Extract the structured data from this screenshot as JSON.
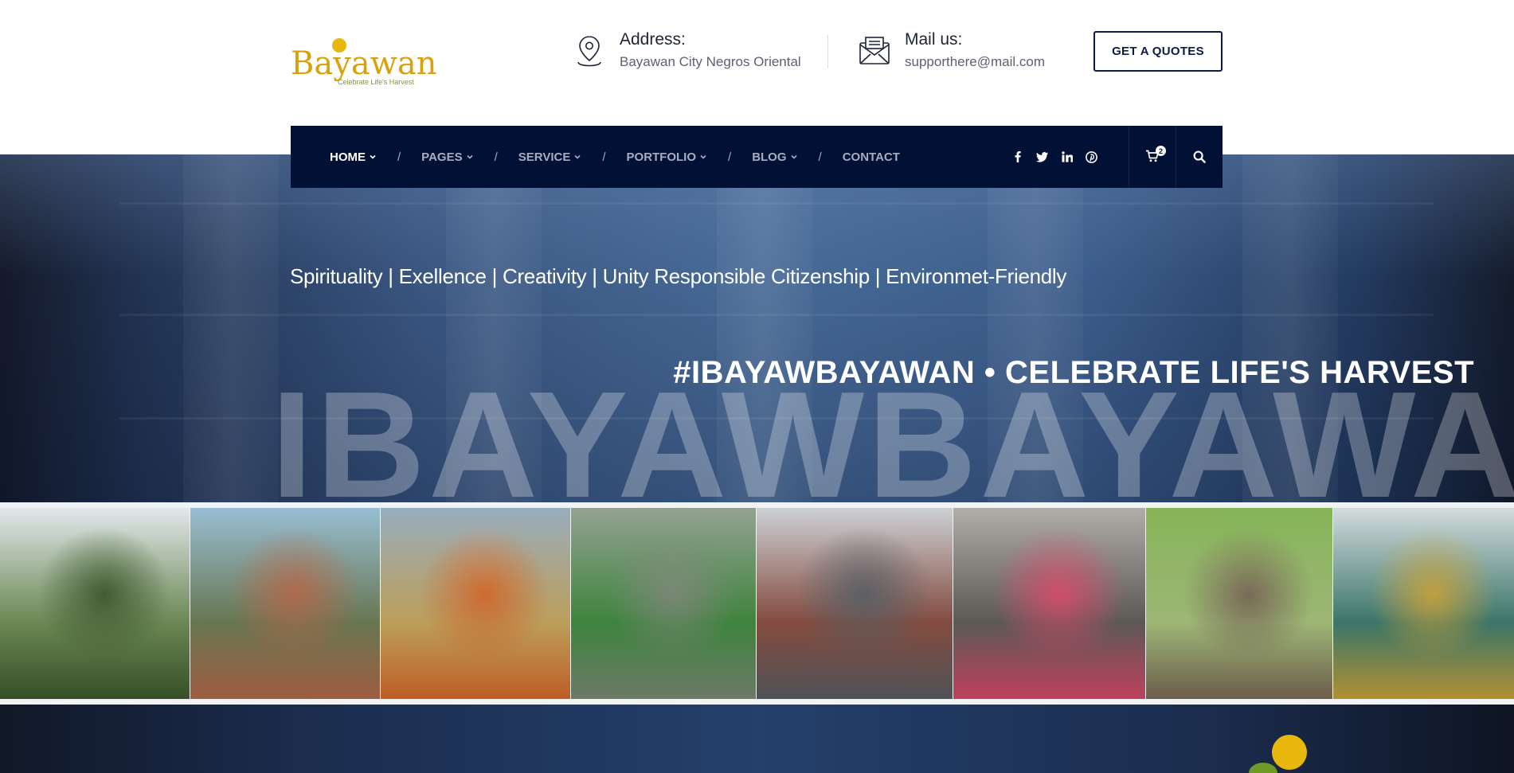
{
  "brand": {
    "logo_text": "Bayawan",
    "logo_tagline": "Celebrate Life's Harvest",
    "colors": {
      "logo_gold": "#d8a20d",
      "logo_green": "#7f9a2e",
      "navy": "#011136"
    }
  },
  "header": {
    "address": {
      "icon": "map-pin-icon",
      "label": "Address:",
      "value": "Bayawan City Negros Oriental"
    },
    "mail": {
      "icon": "envelope-icon",
      "label": "Mail us:",
      "value": "supporthere@mail.com"
    },
    "cta_label": "GET A QUOTES"
  },
  "nav": {
    "items": [
      {
        "label": "HOME",
        "active": true
      },
      {
        "label": "PAGES",
        "active": false
      },
      {
        "label": "SERVICE",
        "active": false
      },
      {
        "label": "PORTFOLIO",
        "active": false
      },
      {
        "label": "BLOG",
        "active": false
      },
      {
        "label": "CONTACT",
        "active": false
      }
    ],
    "separator": "/",
    "socials": [
      "facebook-icon",
      "twitter-icon",
      "linkedin-icon",
      "pinterest-icon"
    ],
    "cart_count": "2"
  },
  "hero": {
    "tagline": "Spirituality | Exellence | Creativity | Unity Responsible Citizenship | Environmet-Friendly",
    "hashtag": "#IBAYAWBAYAWAN • CELEBRATE LIFE'S HARVEST",
    "big_word": "IBAYAWBAYAWAN"
  },
  "photos": [
    {
      "name": "photo-excavator",
      "colors": [
        "#dfe6ea",
        "#6f8e54",
        "#3e5a2c"
      ]
    },
    {
      "name": "photo-fisherman",
      "colors": [
        "#8fb9d0",
        "#6b7b52",
        "#b5694a"
      ]
    },
    {
      "name": "photo-awards",
      "colors": [
        "#8fa6b8",
        "#c9a85c",
        "#d86a2a"
      ]
    },
    {
      "name": "photo-puregold-aerial",
      "colors": [
        "#8a9a88",
        "#3d8a3c",
        "#7b8a76"
      ]
    },
    {
      "name": "photo-building-aerial",
      "colors": [
        "#c9cdd2",
        "#8a4c3e",
        "#5a5e64"
      ]
    },
    {
      "name": "photo-taekwondo",
      "colors": [
        "#aaa6a0",
        "#5e5a56",
        "#d84a6a"
      ]
    },
    {
      "name": "photo-rice-farmer",
      "colors": [
        "#7cae4a",
        "#a6c27a",
        "#7b6a56"
      ]
    },
    {
      "name": "photo-fish-catch",
      "colors": [
        "#cfd8da",
        "#3a7a6c",
        "#c8a43a"
      ]
    }
  ]
}
